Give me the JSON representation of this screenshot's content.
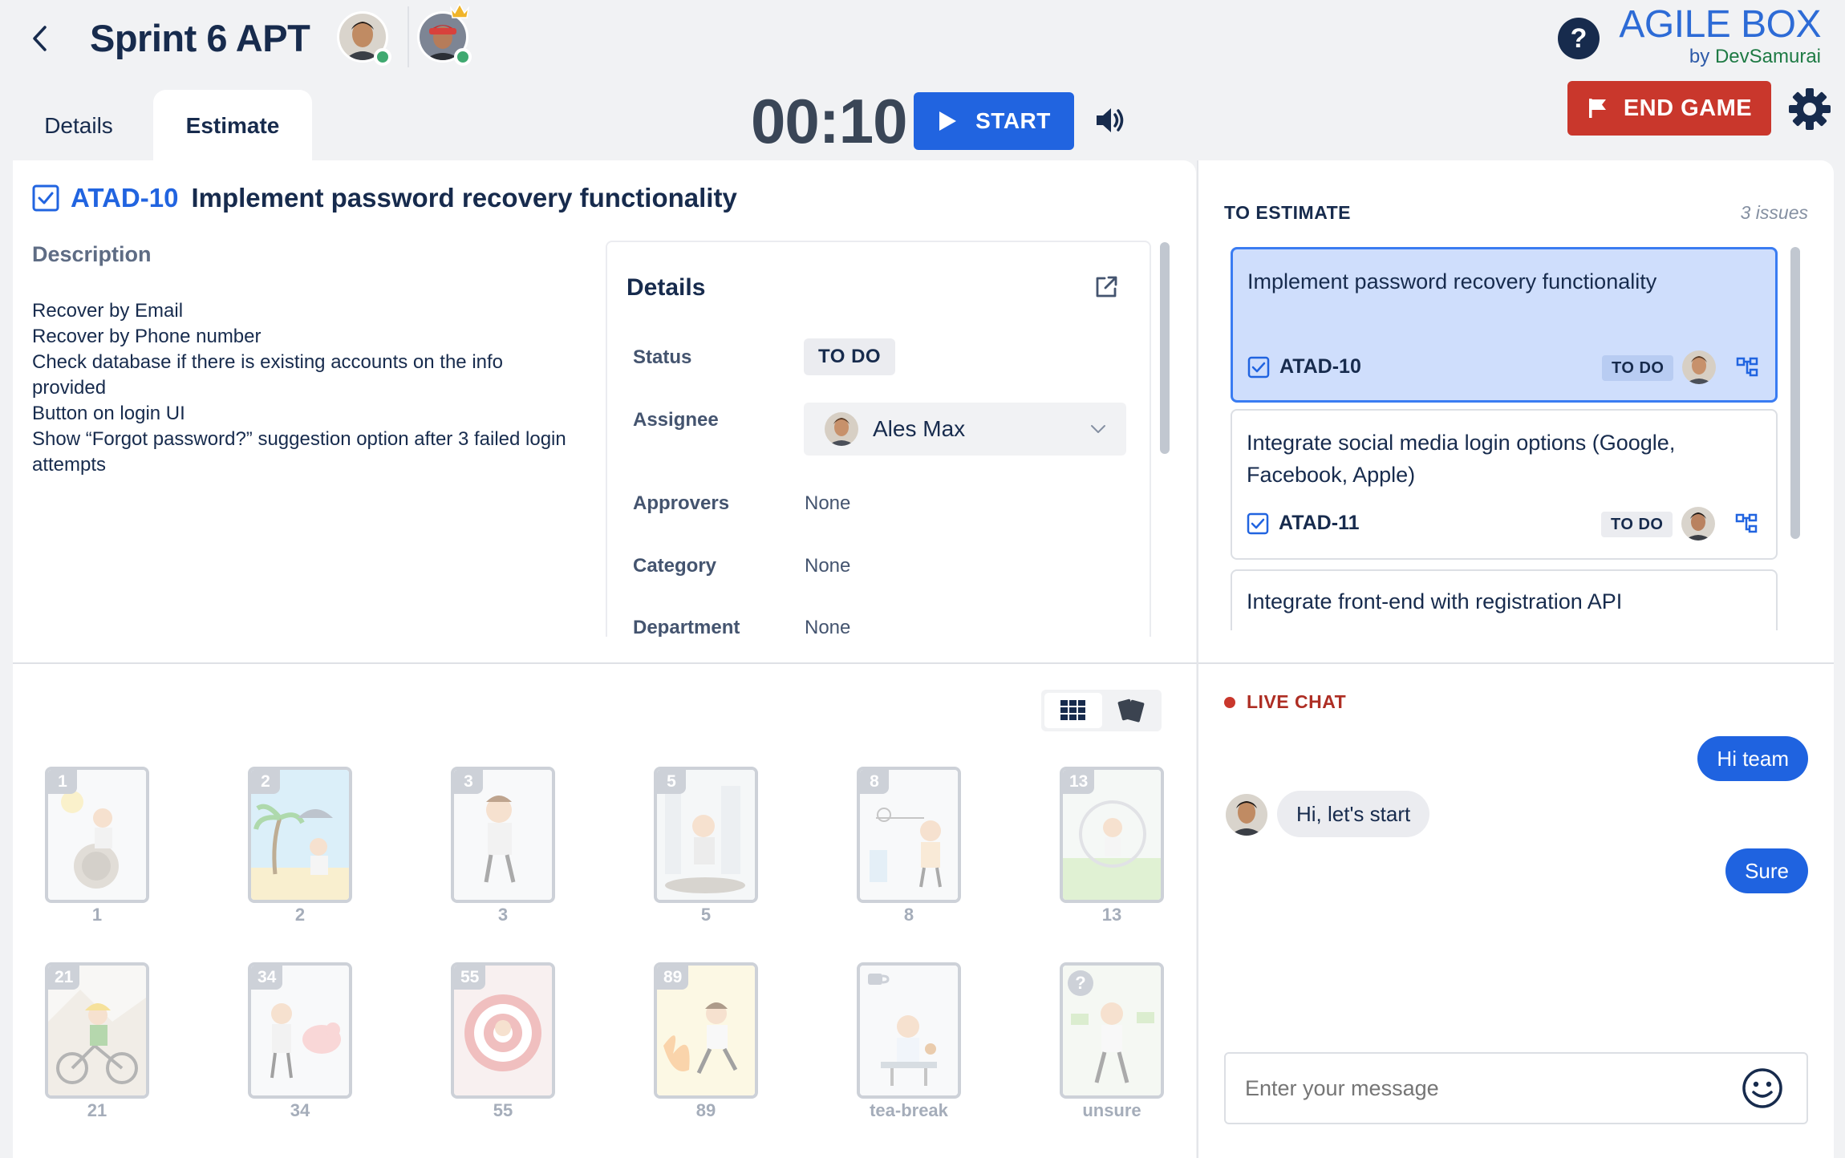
{
  "header": {
    "title": "Sprint 6 APT",
    "tabs": {
      "details": "Details",
      "estimate": "Estimate"
    },
    "timer": "00:10",
    "start_label": "START",
    "end_label": "END GAME",
    "help_label": "?",
    "brand": {
      "title": "AGILE BOX",
      "by": "by",
      "company": "DevSamurai"
    }
  },
  "issue": {
    "key": "ATAD-10",
    "title": "Implement password recovery functionality",
    "description_label": "Description",
    "description_lines": [
      "Recover by Email",
      "Recover by Phone number",
      "Check database if there is existing accounts on the info provided",
      "Button on login UI",
      "Show “Forgot password?” suggestion option after 3 failed login attempts"
    ]
  },
  "details": {
    "title": "Details",
    "status_label": "Status",
    "status_value": "TO DO",
    "assignee_label": "Assignee",
    "assignee_value": "Ales Max",
    "approvers_label": "Approvers",
    "approvers_value": "None",
    "category_label": "Category",
    "category_value": "None",
    "department_label": "Department",
    "department_value": "None"
  },
  "to_estimate": {
    "label": "TO ESTIMATE",
    "count": "3 issues",
    "items": [
      {
        "title": "Implement password recovery functionality",
        "key": "ATAD-10",
        "status": "TO DO"
      },
      {
        "title": "Integrate social media login options (Google, Facebook, Apple)",
        "key": "ATAD-11",
        "status": "TO DO"
      },
      {
        "title": "Integrate front-end with registration API"
      }
    ]
  },
  "cards": [
    {
      "badge": "1",
      "label": "1"
    },
    {
      "badge": "2",
      "label": "2"
    },
    {
      "badge": "3",
      "label": "3"
    },
    {
      "badge": "5",
      "label": "5"
    },
    {
      "badge": "8",
      "label": "8"
    },
    {
      "badge": "13",
      "label": "13"
    },
    {
      "badge": "21",
      "label": "21"
    },
    {
      "badge": "34",
      "label": "34"
    },
    {
      "badge": "55",
      "label": "55"
    },
    {
      "badge": "89",
      "label": "89"
    },
    {
      "badge": "",
      "label": "tea-break"
    },
    {
      "badge": "?",
      "label": "unsure"
    }
  ],
  "chat": {
    "label": "LIVE CHAT",
    "messages": [
      {
        "from": "me",
        "text": "Hi team"
      },
      {
        "from": "other",
        "text": "Hi, let's start"
      },
      {
        "from": "me",
        "text": "Sure"
      }
    ],
    "placeholder": "Enter your message"
  },
  "colors": {
    "primary": "#2164e0",
    "danger": "#c9372c",
    "online": "#3fa970",
    "active_card_bg": "#cfdefc"
  }
}
